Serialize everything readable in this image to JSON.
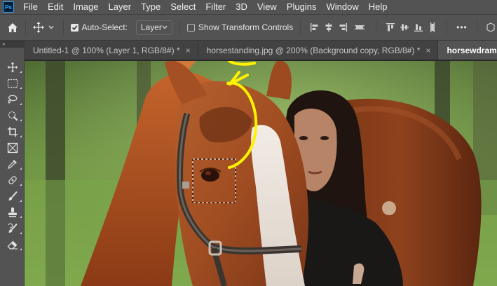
{
  "menubar": {
    "app_badge": "Ps",
    "items": [
      "File",
      "Edit",
      "Image",
      "Layer",
      "Type",
      "Select",
      "Filter",
      "3D",
      "View",
      "Plugins",
      "Window",
      "Help"
    ]
  },
  "options": {
    "auto_select_label": "Auto-Select:",
    "auto_select_checked": true,
    "layer_select_value": "Layer",
    "show_transform_label": "Show Transform Controls",
    "show_transform_checked": false,
    "more_label": "•••"
  },
  "panel_collapse": "»",
  "tabs": [
    {
      "title": "Untitled-1 @ 100% (Layer 1, RGB/8#) *",
      "close": "×",
      "active": false
    },
    {
      "title": "horsestanding.jpg @ 200% (Background copy, RGB/8#) *",
      "close": "×",
      "active": false
    },
    {
      "title": "horsewdrama.jpg @",
      "close": "",
      "active": true
    }
  ],
  "tools": [
    {
      "name": "move-tool",
      "selected": false
    },
    {
      "name": "rectangular-marquee-tool",
      "selected": false
    },
    {
      "name": "lasso-tool",
      "selected": false
    },
    {
      "name": "quick-selection-tool",
      "selected": false
    },
    {
      "name": "crop-tool",
      "selected": false
    },
    {
      "name": "frame-tool",
      "selected": false
    },
    {
      "name": "eyedropper-tool",
      "selected": false
    },
    {
      "name": "spot-healing-brush-tool",
      "selected": false
    },
    {
      "name": "brush-tool",
      "selected": false
    },
    {
      "name": "clone-stamp-tool",
      "selected": false
    },
    {
      "name": "history-brush-tool",
      "selected": false
    },
    {
      "name": "eraser-tool",
      "selected": false
    }
  ],
  "colors": {
    "ui_dark": "#535353",
    "tab_bar": "#424242",
    "annotation_arrow": "#fff200",
    "selection_marquee": "#ffffff"
  }
}
